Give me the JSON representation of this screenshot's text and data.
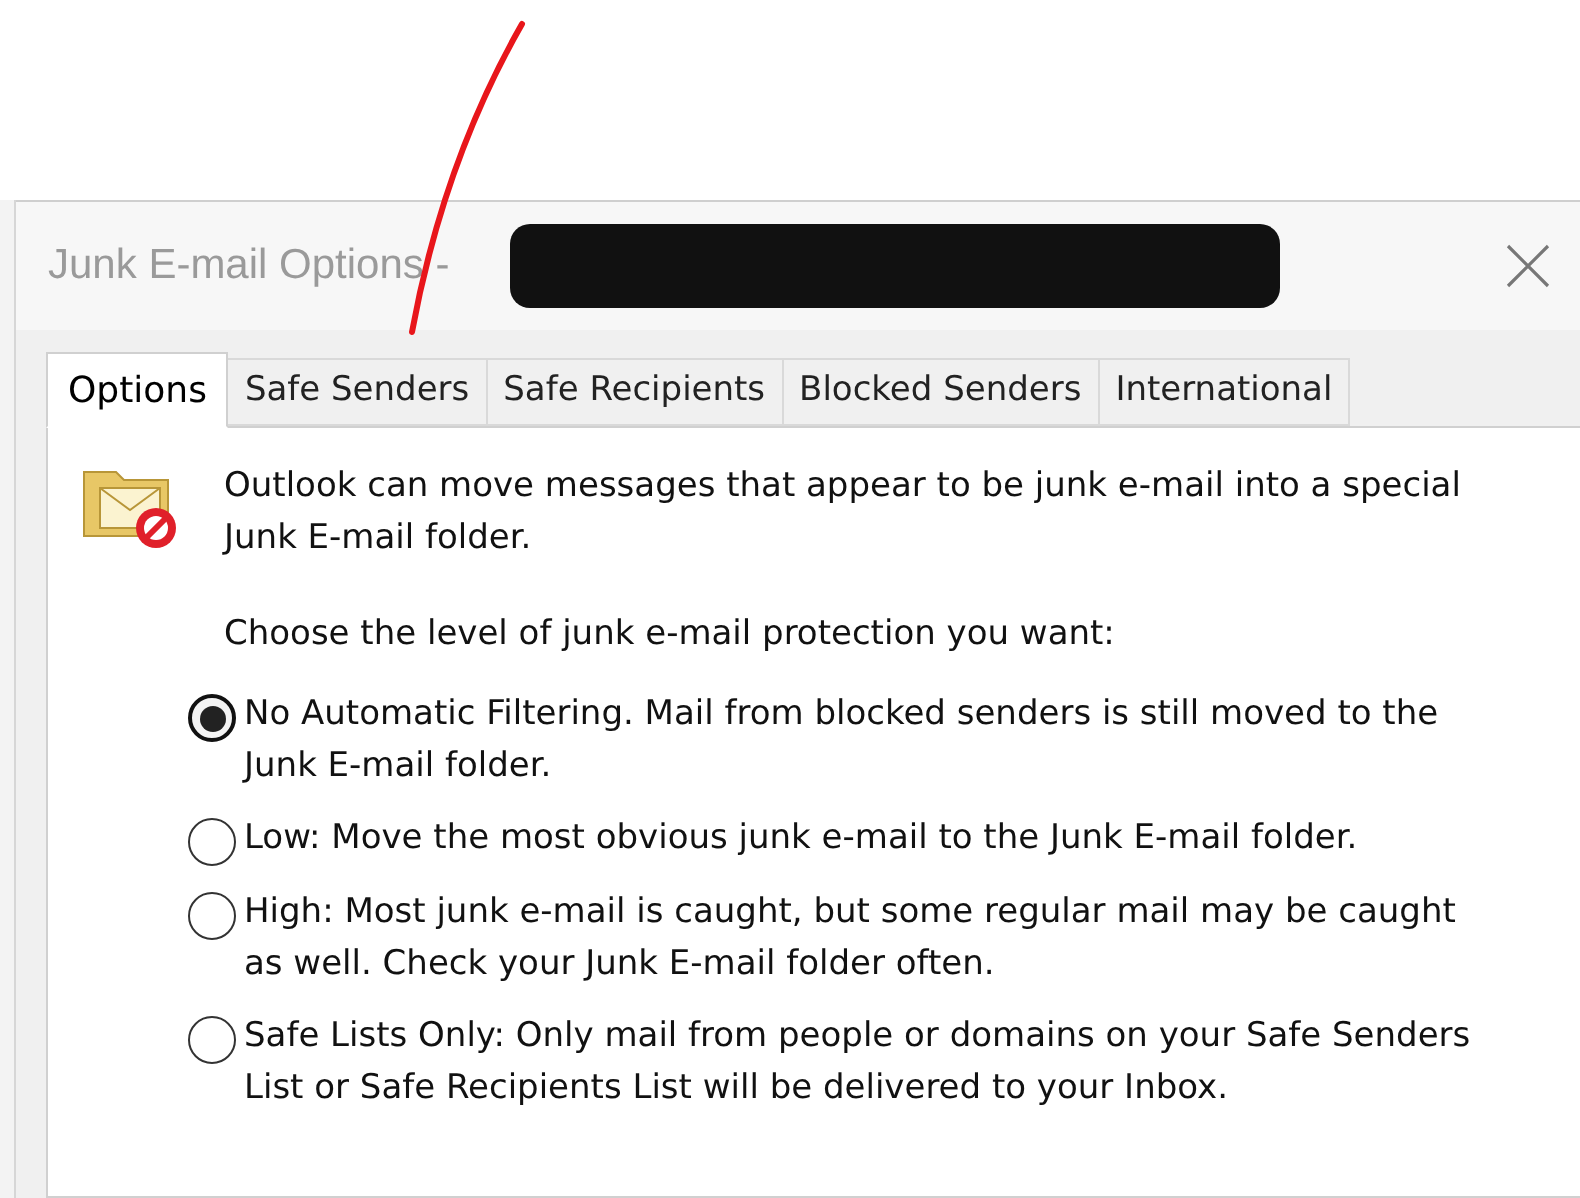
{
  "window": {
    "title": "Junk E-mail Options -"
  },
  "tabs": [
    {
      "label": "Options",
      "selected": true
    },
    {
      "label": "Safe Senders",
      "selected": false
    },
    {
      "label": "Safe Recipients",
      "selected": false
    },
    {
      "label": "Blocked Senders",
      "selected": false
    },
    {
      "label": "International",
      "selected": false
    }
  ],
  "intro": "Outlook can move messages that appear to be junk e-mail into a special Junk E-mail folder.",
  "prompt": "Choose the level of junk e-mail protection you want:",
  "levels": [
    {
      "label": "No Automatic Filtering. Mail from blocked senders is still moved to the Junk E-mail folder.",
      "selected": true
    },
    {
      "label": "Low: Move the most obvious junk e-mail to the Junk E-mail folder.",
      "selected": false
    },
    {
      "label": "High: Most junk e-mail is caught, but some regular mail may be caught as well. Check your Junk E-mail folder often.",
      "selected": false
    },
    {
      "label": "Safe Lists Only: Only mail from people or domains on your Safe Senders List or Safe Recipients List will be delivered to your Inbox.",
      "selected": false
    }
  ]
}
